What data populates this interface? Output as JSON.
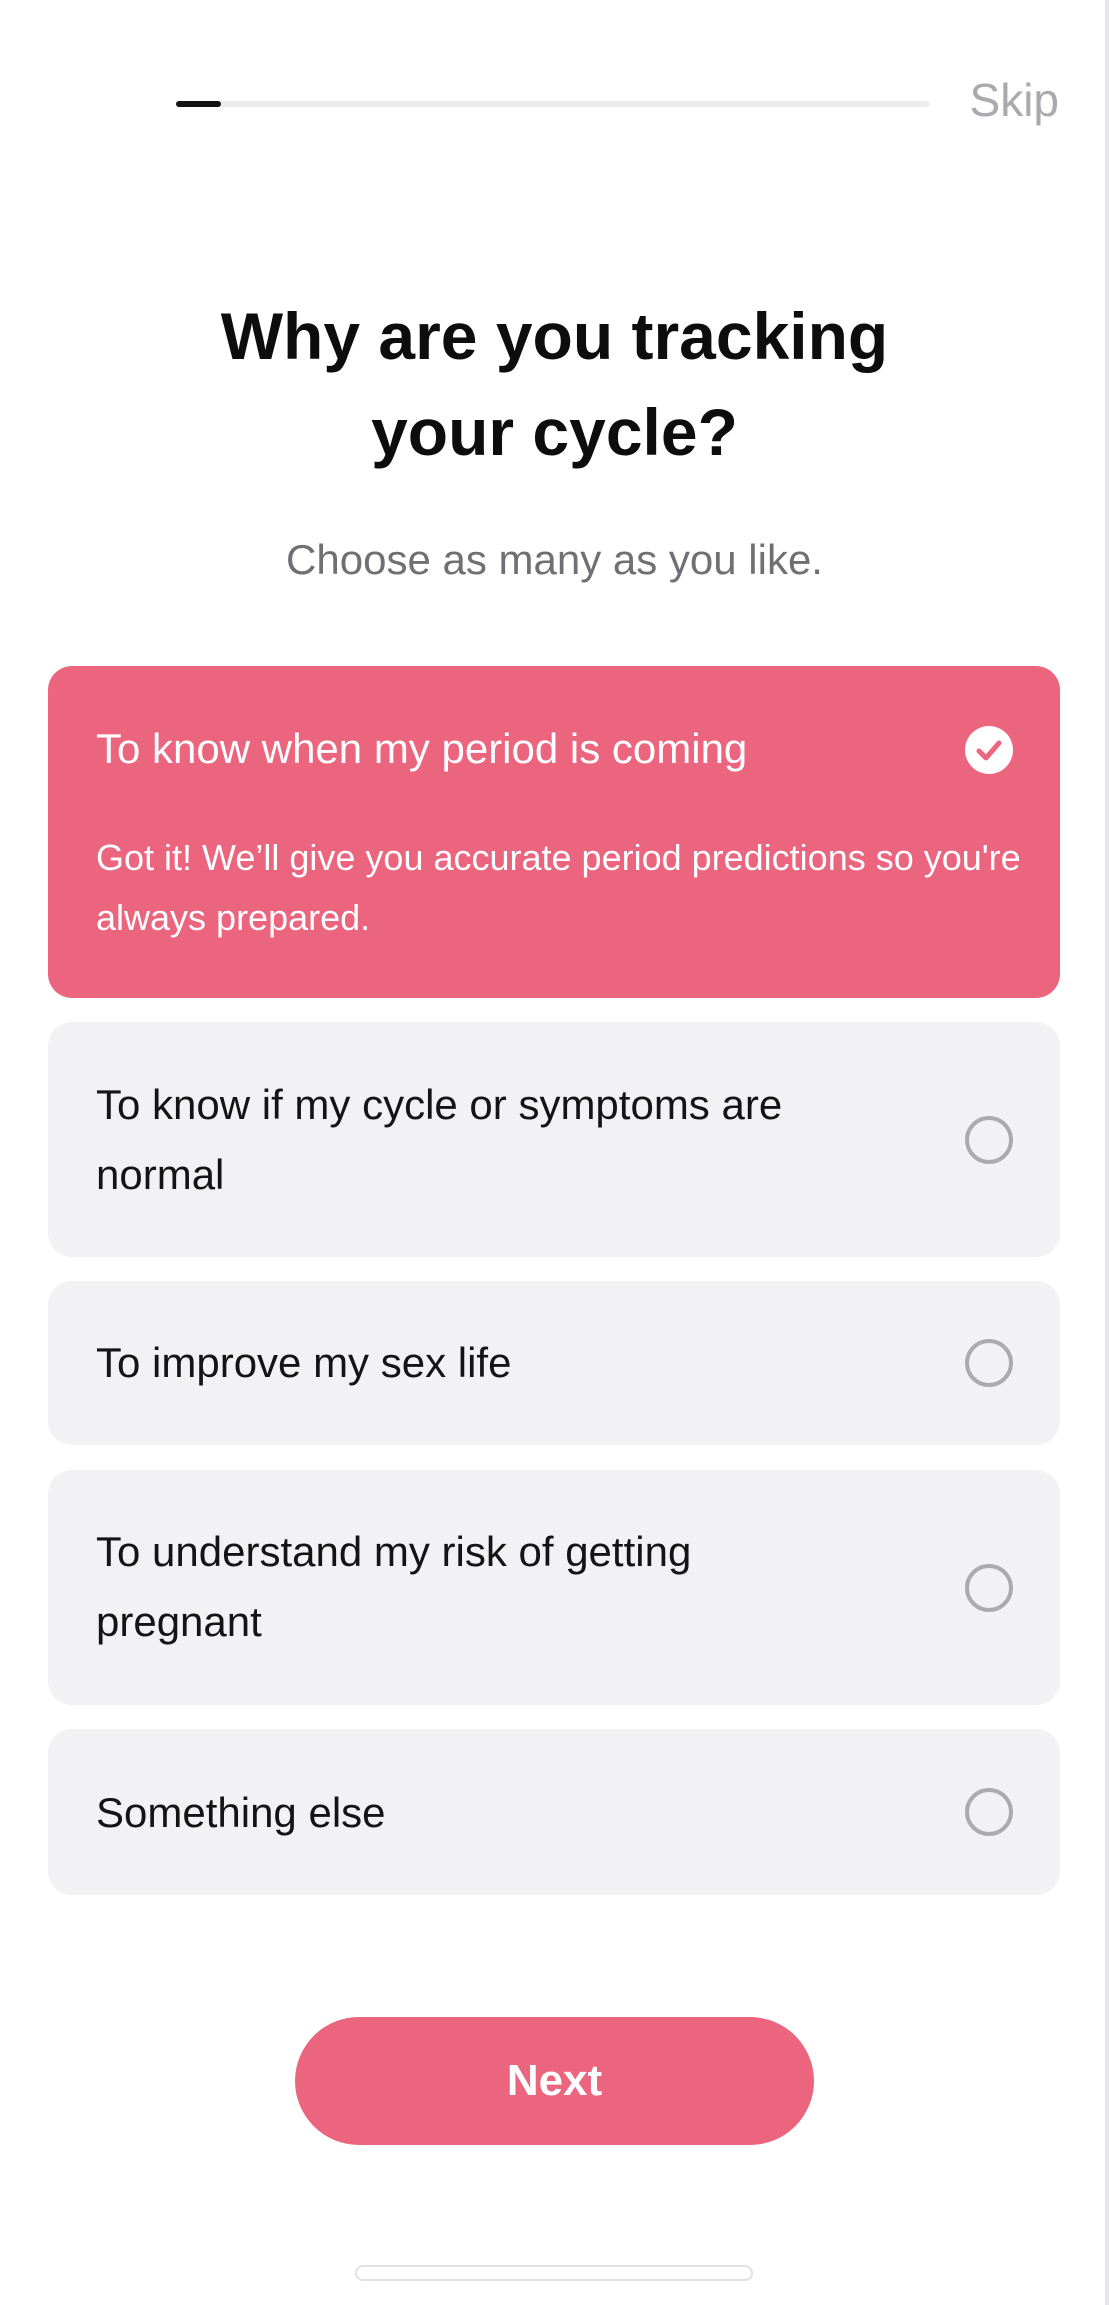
{
  "header": {
    "progress": 0.06,
    "skip_label": "Skip"
  },
  "question": {
    "title_line1": "Why are you tracking",
    "title_line2": "your cycle?",
    "subtitle": "Choose as many as you like."
  },
  "options": [
    {
      "label": "To know when my period is coming",
      "selected": true,
      "description": "Got it! We’ll give you accurate period predictions so you're always prepared."
    },
    {
      "label": "To know if my cycle or symptoms are normal",
      "selected": false
    },
    {
      "label": "To improve my sex life",
      "selected": false
    },
    {
      "label": "To understand my risk of getting pregnant",
      "selected": false
    },
    {
      "label": "Something else",
      "selected": false
    }
  ],
  "next_label": "Next",
  "colors": {
    "accent": "#ec657e",
    "option_background": "#f2f2f4",
    "progress_fill": "#141414",
    "skip_text": "#a9a9ae"
  }
}
